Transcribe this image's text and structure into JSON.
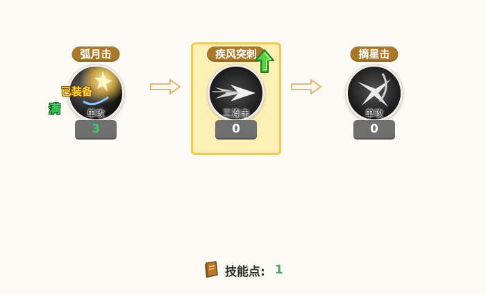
{
  "skills": [
    {
      "name": "弧月击",
      "type": "单攻",
      "level": "3",
      "equipped_text": "已装备",
      "max_text": "满",
      "icon": "crescent-slash-icon"
    },
    {
      "name": "疾风突刺",
      "type": "三连击",
      "level": "0",
      "icon": "gale-thrust-icon",
      "upgrade_icon": "green-up-arrow-icon"
    },
    {
      "name": "摘星击",
      "type": "单攻",
      "level": "0",
      "icon": "star-pluck-icon"
    }
  ],
  "footer": {
    "label": "技能点:",
    "value": "1",
    "icon": "skill-book-icon"
  },
  "colors": {
    "name_plate": "#a9782a",
    "selected_bg": "#fdf0b5",
    "selected_border": "#f2c94a",
    "level_box": "#6f6f6f",
    "equipped_level": "#41c46f"
  }
}
